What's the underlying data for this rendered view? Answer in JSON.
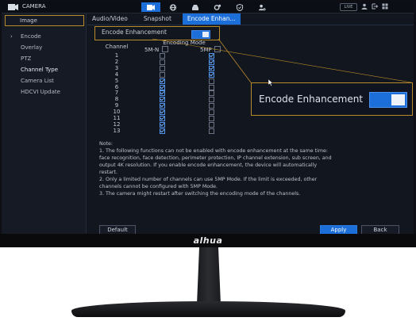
{
  "app": {
    "title": "CAMERA",
    "live_badge": "LIVE"
  },
  "nav_icons": [
    "camera-icon",
    "network-icon",
    "storage-icon",
    "settings-icon",
    "security-icon",
    "account-icon"
  ],
  "sidebar": {
    "header": "Image",
    "items": [
      {
        "label": "Encode",
        "expanded": true
      },
      {
        "label": "Overlay"
      },
      {
        "label": "PTZ"
      },
      {
        "label": "Channel Type"
      },
      {
        "label": "Camera List"
      },
      {
        "label": "HDCVI Update"
      }
    ]
  },
  "tabs": [
    "Audio/Video",
    "Snapshot",
    "Encode Enhan..."
  ],
  "encode_enhancement": {
    "label": "Encode Enhancement",
    "enabled": true
  },
  "table": {
    "group_header": "Encoding Mode",
    "col_channel": "Channel",
    "col_5mn": "5M-N",
    "col_5mp": "5MP",
    "rows": [
      {
        "ch": "1",
        "mn": false,
        "mp": true
      },
      {
        "ch": "2",
        "mn": false,
        "mp": true
      },
      {
        "ch": "3",
        "mn": false,
        "mp": true
      },
      {
        "ch": "4",
        "mn": false,
        "mp": true
      },
      {
        "ch": "5",
        "mn": true,
        "mp": false
      },
      {
        "ch": "6",
        "mn": true,
        "mp": false
      },
      {
        "ch": "7",
        "mn": true,
        "mp": false
      },
      {
        "ch": "8",
        "mn": true,
        "mp": false
      },
      {
        "ch": "9",
        "mn": true,
        "mp": false
      },
      {
        "ch": "10",
        "mn": true,
        "mp": false
      },
      {
        "ch": "11",
        "mn": true,
        "mp": false
      },
      {
        "ch": "12",
        "mn": true,
        "mp": false
      },
      {
        "ch": "13",
        "mn": true,
        "mp": false
      }
    ]
  },
  "callout": {
    "label": "Encode Enhancement"
  },
  "notes": {
    "title": "Note:",
    "lines": [
      "1. The following functions can not be enabled with encode enhancement at the same time:",
      "face recognition, face detection, perimeter protection, IP channel extension, sub screen, and",
      "output 4K resolution. If you enable encode enhancement, the device will automatically",
      "restart.",
      "2. Only a limited number of channels can use 5MP Mode. If the limit is exceeded, other",
      "channels cannot be configured with 5MP Mode.",
      "3. The camera might restart after switching the encoding mode of the channels."
    ]
  },
  "buttons": {
    "default": "Default",
    "apply": "Apply",
    "back": "Back"
  },
  "brand": "alhua",
  "colors": {
    "accent": "#1c6fd8",
    "highlight_border": "#b98a2a",
    "background": "#12161f"
  }
}
